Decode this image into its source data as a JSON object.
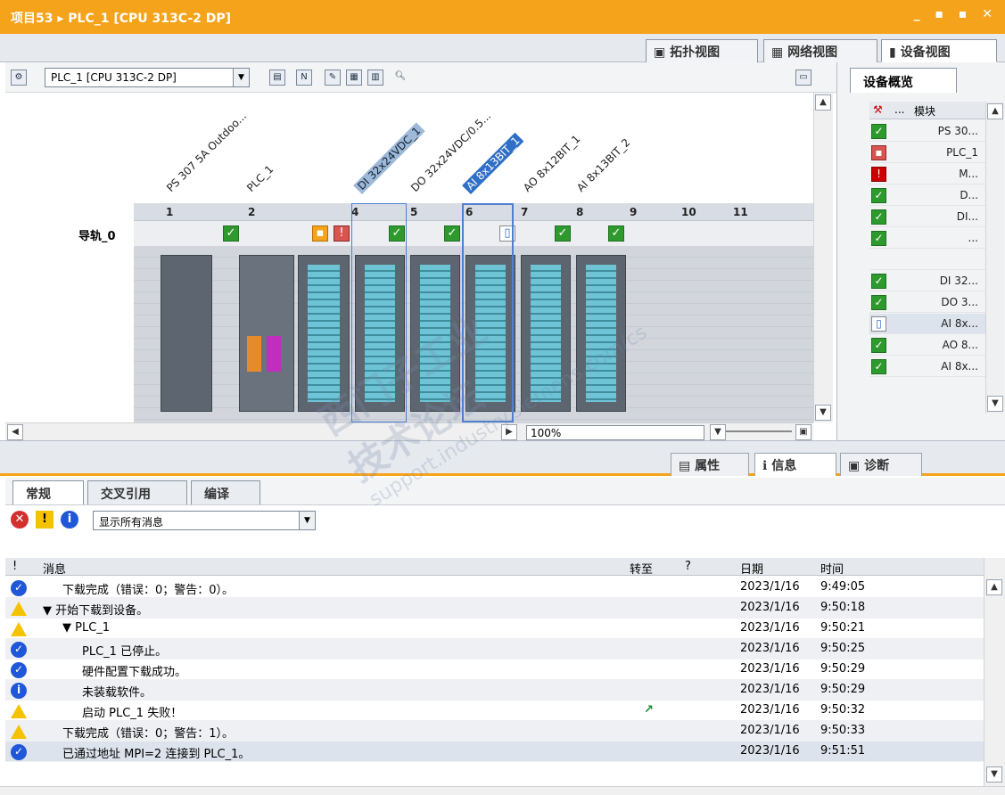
{
  "title_bar": {
    "title": "项目53 ▸ PLC_1 [CPU 313C-2 DP]",
    "controls": "_ ▪ ▪ ✕"
  },
  "view_tabs": [
    "拓扑视图",
    "网络视图",
    "设备视图"
  ],
  "toolbar": {
    "device_select": "PLC_1 [CPU 313C-2 DP]"
  },
  "modules": [
    {
      "label": "PS 307 5A Outdoo..."
    },
    {
      "label": "PLC_1"
    },
    {
      "label": "DI 32x24VDC_1"
    },
    {
      "label": "DO 32x24VDC/0.5..."
    },
    {
      "label": "AI 8x13BIT_1"
    },
    {
      "label": "AO 8x12BIT_1"
    },
    {
      "label": "AI 8x13BIT_2"
    }
  ],
  "slots": [
    "1",
    "2",
    "4",
    "5",
    "6",
    "7",
    "8",
    "9",
    "10",
    "11"
  ],
  "rail_name": "导轨_0",
  "zoom": "100%",
  "overview": {
    "tab": "设备概览",
    "header_dots": "...",
    "header_module": "模块",
    "rows": [
      "PS 30...",
      "PLC_1",
      "M...",
      "D...",
      "DI...",
      "...",
      "",
      "DI 32...",
      "DO 3...",
      "AI 8x...",
      "AO 8...",
      "AI 8x..."
    ]
  },
  "inspector_tabs": [
    "属性",
    "信息",
    "诊断"
  ],
  "sub_tabs": [
    "常规",
    "交叉引用",
    "编译"
  ],
  "filter": {
    "select": "显示所有消息"
  },
  "messages_header": {
    "excl": "!",
    "msg": "消息",
    "goto": "转至",
    "q": "?",
    "date": "日期",
    "time": "时间"
  },
  "messages": [
    {
      "icon": "ok",
      "text": "下载完成（错误：0；警告：0）。",
      "date": "2023/1/16",
      "time": "9:49:05",
      "indent": 1
    },
    {
      "icon": "warn",
      "text": "▼  开始下载到设备。",
      "date": "2023/1/16",
      "time": "9:50:18",
      "indent": 0
    },
    {
      "icon": "warn",
      "text": "▼  PLC_1",
      "date": "2023/1/16",
      "time": "9:50:21",
      "indent": 1
    },
    {
      "icon": "ok",
      "text": "PLC_1 已停止。",
      "date": "2023/1/16",
      "time": "9:50:25",
      "indent": 2
    },
    {
      "icon": "ok",
      "text": "硬件配置下载成功。",
      "date": "2023/1/16",
      "time": "9:50:29",
      "indent": 2
    },
    {
      "icon": "info",
      "text": "未装载软件。",
      "date": "2023/1/16",
      "time": "9:50:29",
      "indent": 2
    },
    {
      "icon": "warn",
      "text": "启动 PLC_1 失败！",
      "date": "2023/1/16",
      "time": "9:50:32",
      "indent": 2,
      "goto": "↗"
    },
    {
      "icon": "warn",
      "text": "下载完成（错误：0；警告：1）。",
      "date": "2023/1/16",
      "time": "9:50:33",
      "indent": 1
    },
    {
      "icon": "ok",
      "text": "已通过地址 MPI=2 连接到 PLC_1。",
      "date": "2023/1/16",
      "time": "9:51:51",
      "indent": 1
    }
  ],
  "watermark": {
    "line1": "西门子工业",
    "line2": "技术论坛",
    "url": "support.industry.siemens.com/cs"
  },
  "colors": {
    "accent": "#f5a31a",
    "ok": "#1f57d8",
    "warn": "#f5c200",
    "check": "#2e9a2e"
  }
}
